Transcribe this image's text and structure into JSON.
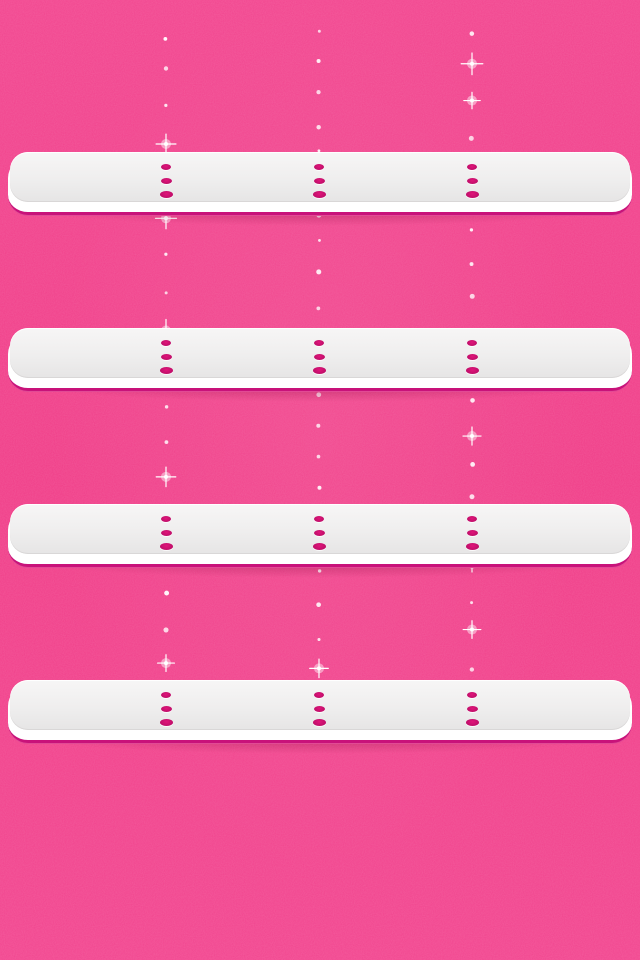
{
  "screen": {
    "type": "ios-home-screen-wallpaper",
    "background_color": "#f03d88",
    "shelf_color": "#f2f1f1",
    "accent_color": "#c8127a",
    "sparkle_color": "#ffffff"
  },
  "shelves": [
    {
      "name": "shelf-1",
      "hole_columns": 3
    },
    {
      "name": "shelf-2",
      "hole_columns": 3
    },
    {
      "name": "shelf-3",
      "hole_columns": 3
    },
    {
      "name": "shelf-4",
      "hole_columns": 3
    }
  ],
  "strands": [
    {
      "name": "strand-left",
      "bead_count": 18
    },
    {
      "name": "strand-center",
      "bead_count": 22
    },
    {
      "name": "strand-right",
      "bead_count": 20
    }
  ]
}
